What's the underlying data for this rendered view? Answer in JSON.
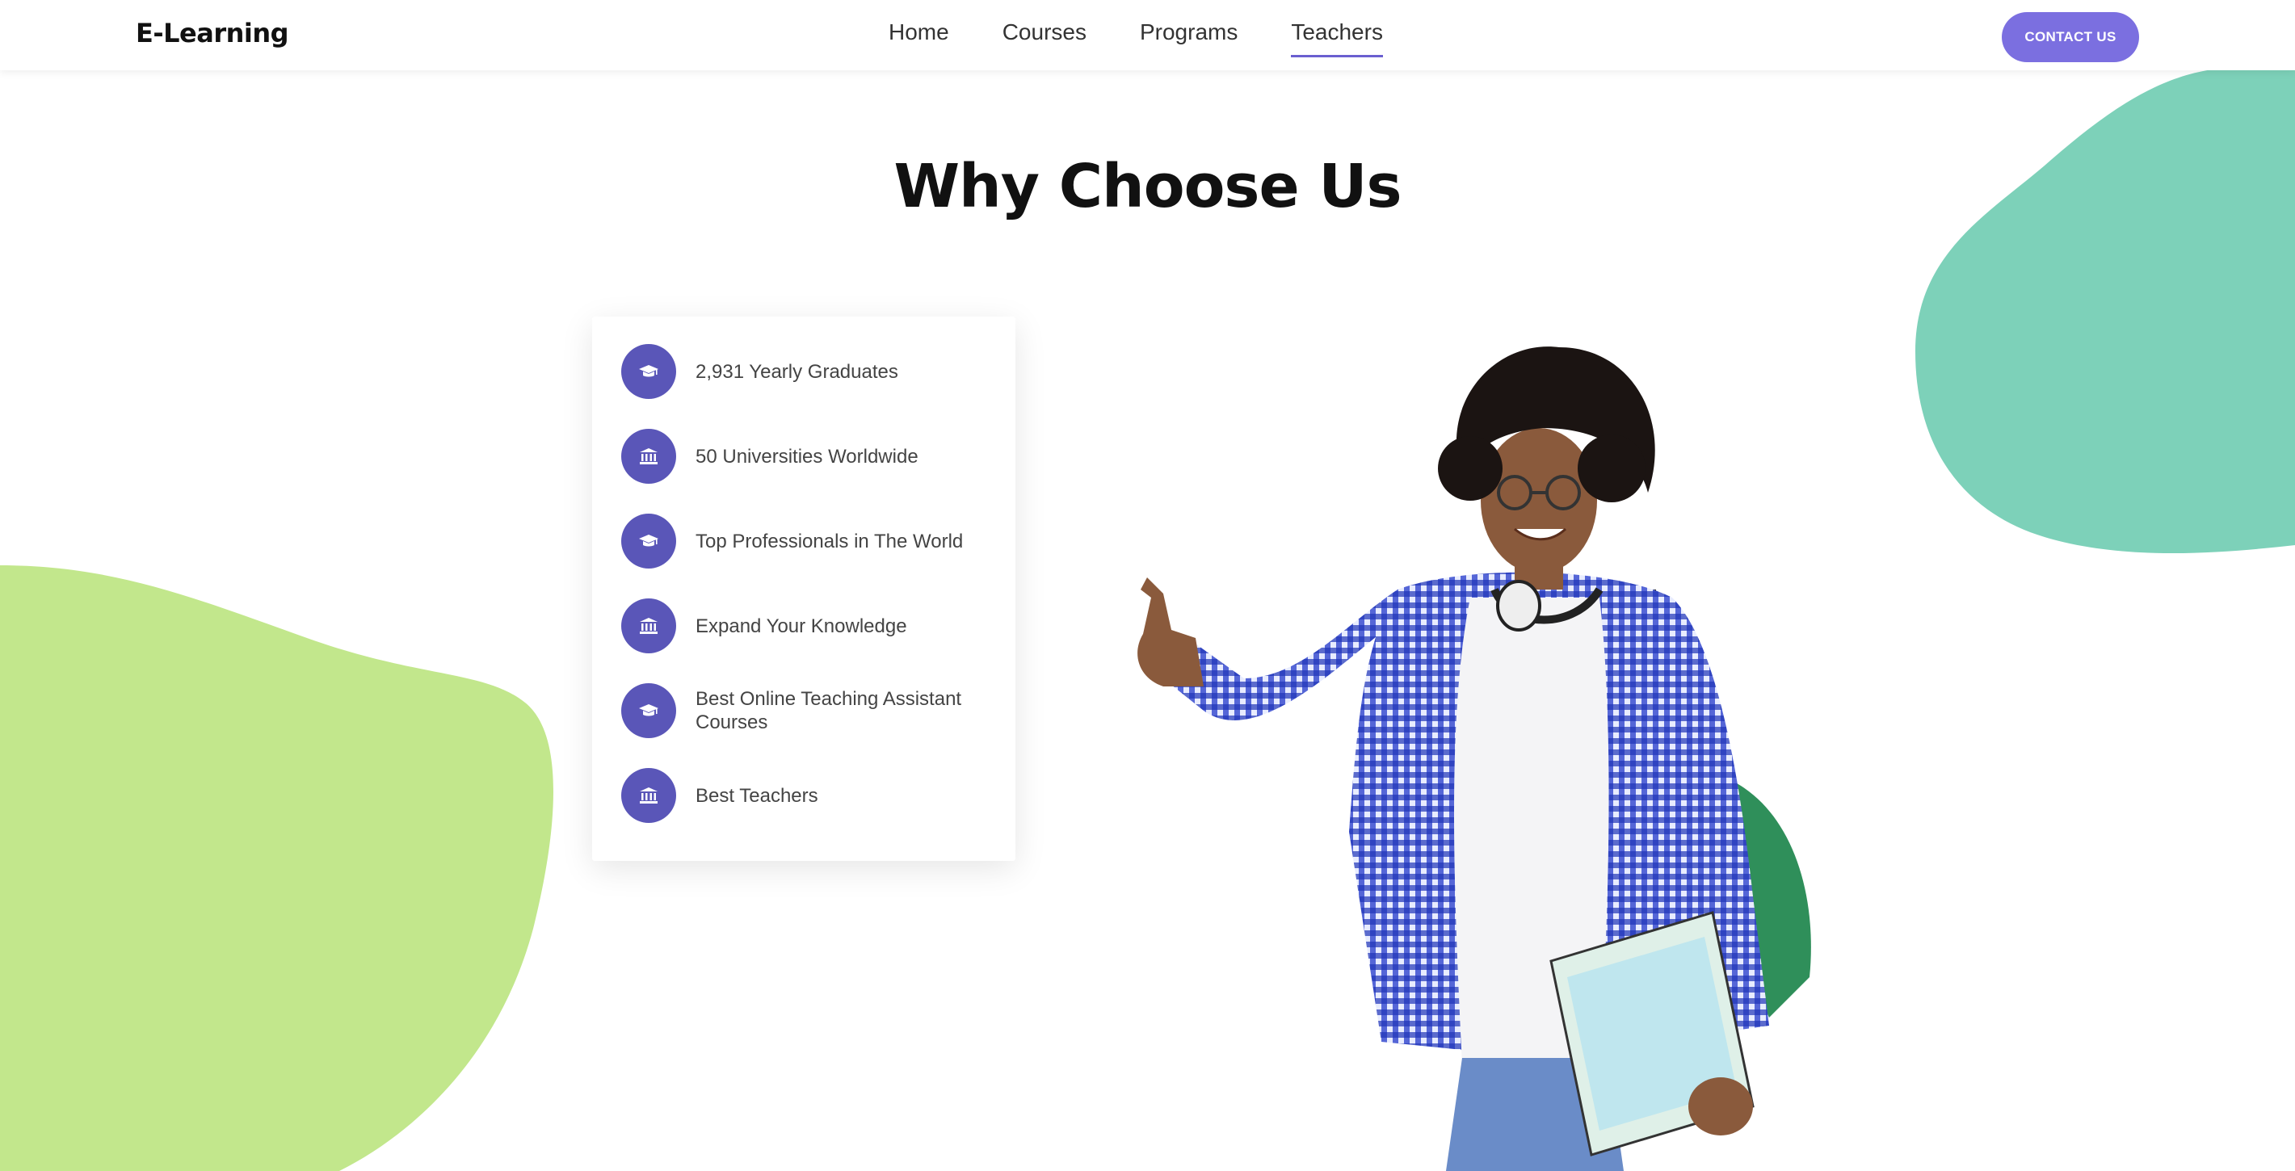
{
  "brand": {
    "name": "E-Learning"
  },
  "nav": {
    "links": [
      {
        "label": "Home",
        "active": false
      },
      {
        "label": "Courses",
        "active": false
      },
      {
        "label": "Programs",
        "active": false
      },
      {
        "label": "Teachers",
        "active": true
      }
    ],
    "contact_label": "CONTACT US"
  },
  "section": {
    "title": "Why Choose Us",
    "features": [
      {
        "icon": "graduation-cap-icon",
        "text": "2,931 Yearly Graduates"
      },
      {
        "icon": "university-icon",
        "text": "50 Universities Worldwide"
      },
      {
        "icon": "graduation-cap-icon",
        "text": "Top Professionals in The World"
      },
      {
        "icon": "university-icon",
        "text": "Expand Your Knowledge"
      },
      {
        "icon": "graduation-cap-icon",
        "text": "Best Online Teaching Assistant Courses"
      },
      {
        "icon": "university-icon",
        "text": "Best Teachers"
      }
    ]
  },
  "colors": {
    "accent": "#7b6fe0",
    "icon_bg": "#5a56b8",
    "green_blob": "#c2e78c",
    "teal_blob": "#7dd1b9"
  }
}
